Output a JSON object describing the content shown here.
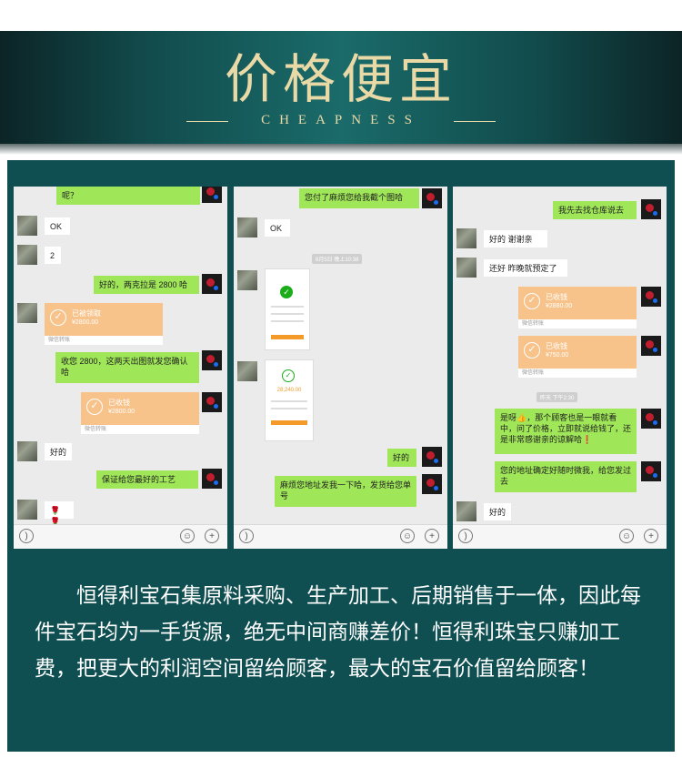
{
  "header": {
    "title": "价格便宜",
    "subtitle": "CHEAPNESS"
  },
  "chat1": {
    "m1": "呢？",
    "m2": "OK",
    "m3": "2",
    "m4": "好的，两克拉是 2800 哈",
    "card1_title": "已被领取",
    "card1_amount": "¥2800.00",
    "card1_foot": "微信转账",
    "m5": "收您 2800，这两天出图就发您确认哈",
    "card2_title": "已收钱",
    "card2_amount": "¥2800.00",
    "card2_foot": "微信转账",
    "m6": "好的",
    "m7": "保证给您最好的工艺",
    "m8": "🌹🌹"
  },
  "chat2": {
    "m1": "您付了麻烦您给我截个图哈",
    "m2": "OK",
    "time1": "8月5日 晚上10:38",
    "img_amount": "28,240.00",
    "m3": "好的",
    "m4": "麻烦您地址发我一下哈，发货给您单号"
  },
  "chat3": {
    "m1": "我先去找仓库说去",
    "m2": "好的 谢谢亲",
    "m3": "还好 昨晚就预定了",
    "card1_title": "已收钱",
    "card1_amount": "¥2880.00",
    "card1_foot": "微信转账",
    "card2_title": "已收钱",
    "card2_amount": "¥750.00",
    "card2_foot": "微信转账",
    "time1": "昨天 下午2:30",
    "m4": "是呀👍，那个顾客也是一眼就看中，问了价格，立即就说给钱了，还是非常感谢亲的谅解哈❗",
    "m5": "您的地址确定好随时微我，给您发过去",
    "m6": "好的"
  },
  "description": "恒得利宝石集原料采购、生产加工、后期销售于一体，因此每件宝石均为一手货源，绝无中间商赚差价！恒得利珠宝只赚加工费，把更大的利润空间留给顾客，最大的宝石价值留给顾客！"
}
